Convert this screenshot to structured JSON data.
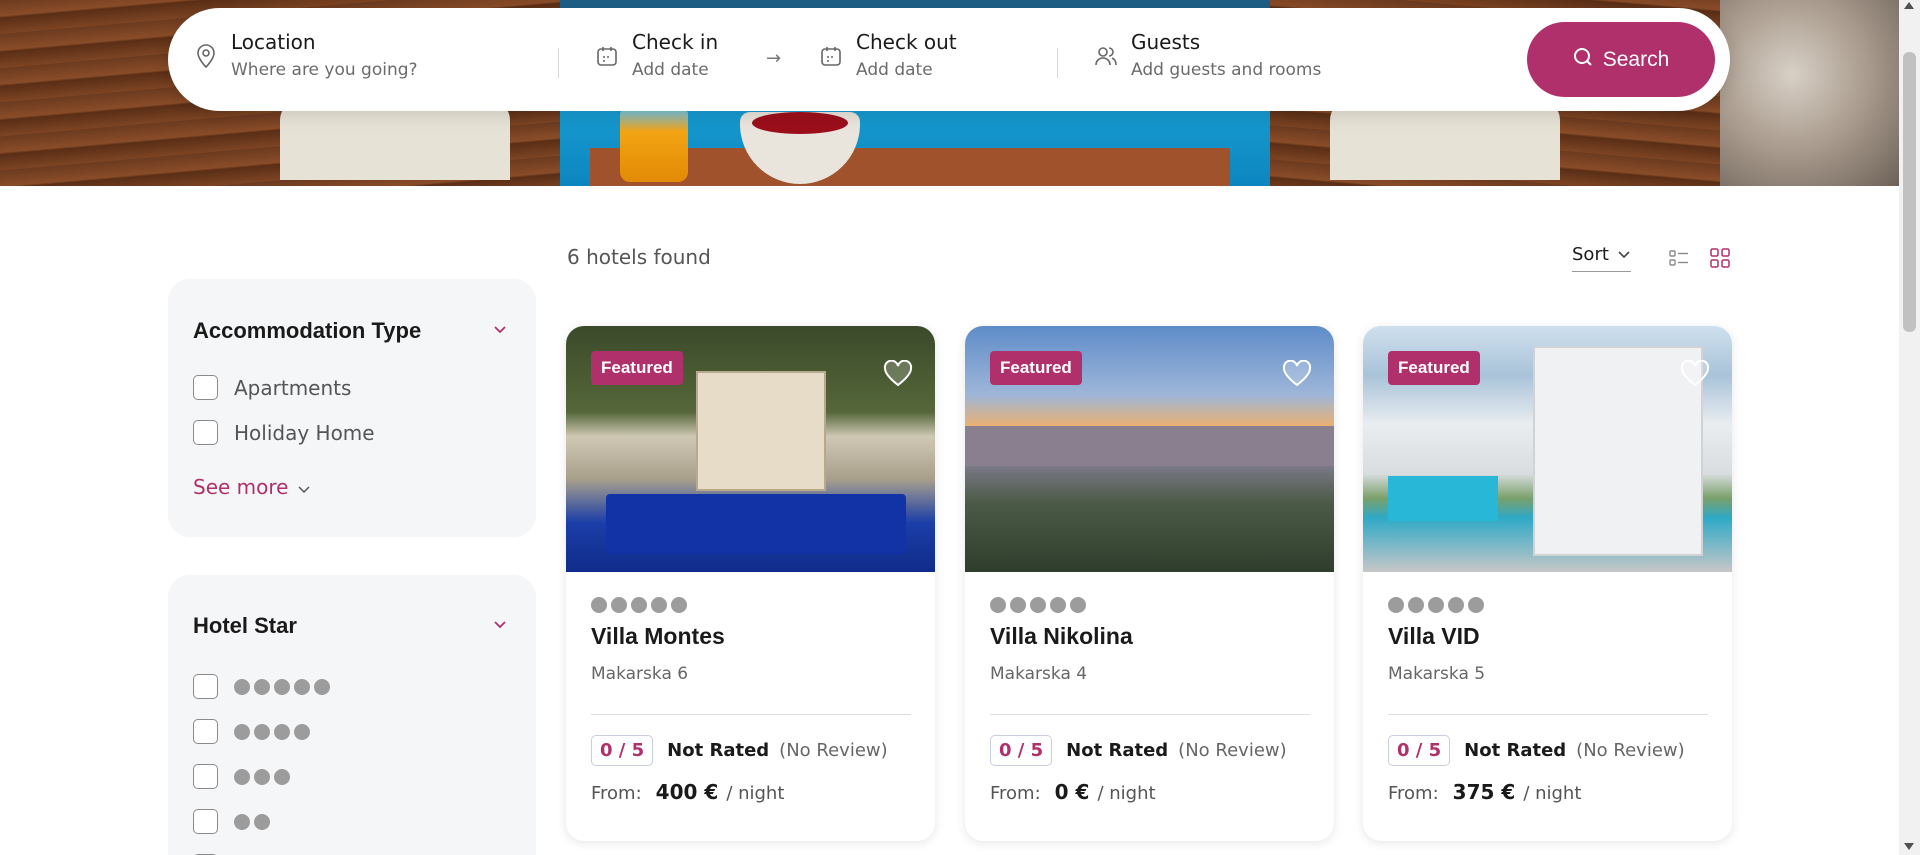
{
  "search": {
    "location_label": "Location",
    "location_placeholder": "Where are you going?",
    "checkin_label": "Check in",
    "checkin_placeholder": "Add date",
    "checkout_label": "Check out",
    "checkout_placeholder": "Add date",
    "guests_label": "Guests",
    "guests_placeholder": "Add guests and rooms",
    "button_label": "Search"
  },
  "results": {
    "count_text": "6 hotels found",
    "sort_label": "Sort"
  },
  "filters": {
    "accommodation": {
      "title": "Accommodation Type",
      "options": [
        "Apartments",
        "Holiday Home"
      ],
      "see_more": "See more"
    },
    "hotel_star": {
      "title": "Hotel Star",
      "levels": [
        5,
        4,
        3,
        2
      ]
    }
  },
  "hotels": [
    {
      "badge": "Featured",
      "name": "Villa Montes",
      "location": "Makarska 6",
      "rating": "0 / 5",
      "rating_text": "Not Rated",
      "reviews": "(No Review)",
      "from_label": "From:",
      "price": "400 €",
      "unit": "/ night"
    },
    {
      "badge": "Featured",
      "name": "Villa Nikolina",
      "location": "Makarska 4",
      "rating": "0 / 5",
      "rating_text": "Not Rated",
      "reviews": "(No Review)",
      "from_label": "From:",
      "price": "0 €",
      "unit": "/ night"
    },
    {
      "badge": "Featured",
      "name": "Villa VID",
      "location": "Makarska 5",
      "rating": "0 / 5",
      "rating_text": "Not Rated",
      "reviews": "(No Review)",
      "from_label": "From:",
      "price": "375 €",
      "unit": "/ night"
    }
  ],
  "colors": {
    "accent": "#b0306b",
    "panel_bg": "#f5f6f8"
  },
  "icons": {
    "location": "map-pin-icon",
    "calendar": "calendar-icon",
    "arrow": "arrow-right-icon",
    "guests": "users-icon",
    "search": "search-icon",
    "heart": "heart-icon",
    "list_view": "list-view-icon",
    "grid_view": "grid-view-icon",
    "chevron": "chevron-down-icon"
  }
}
